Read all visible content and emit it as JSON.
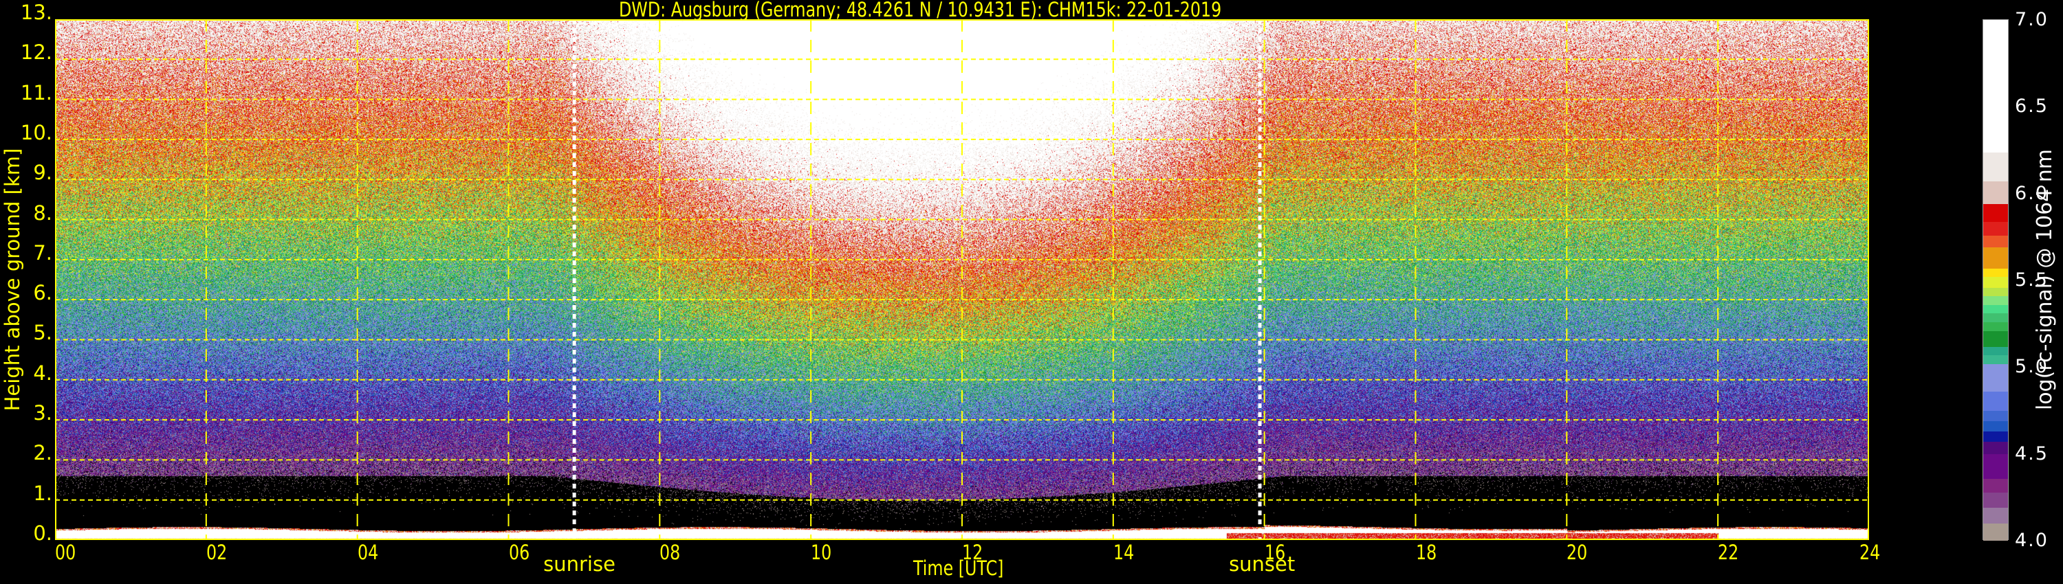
{
  "chart_data": {
    "type": "heatmap",
    "title": "DWD: Augsburg (Germany; 48.4261 N / 10.9431 E):    CHM15k: 22-01-2019",
    "xlabel": "Time [UTC]",
    "ylabel": "Height above ground [km]",
    "xlim": [
      0,
      24
    ],
    "ylim": [
      0,
      13
    ],
    "x_ticks": [
      0,
      2,
      4,
      6,
      8,
      10,
      12,
      14,
      16,
      18,
      20,
      22,
      24
    ],
    "x_tick_labels": [
      "00",
      "02",
      "04",
      "06",
      "08",
      "10",
      "12",
      "14",
      "16",
      "18",
      "20",
      "22",
      "24"
    ],
    "y_ticks": [
      0,
      1,
      2,
      3,
      4,
      5,
      6,
      7,
      8,
      9,
      10,
      11,
      12,
      13
    ],
    "y_tick_labels": [
      "0.",
      "1.",
      "2.",
      "3.",
      "4.",
      "5.",
      "6.",
      "7.",
      "8.",
      "9.",
      "10.",
      "11.",
      "12.",
      "13."
    ],
    "grid": true,
    "annotations": [
      {
        "label": "sunrise",
        "time": 6.87
      },
      {
        "label": "sunset",
        "time": 15.94
      }
    ],
    "colorbar": {
      "label": "log(rc-signal) @ 1064 nm",
      "range": [
        4.0,
        7.0
      ],
      "ticks": [
        "4.0",
        "4.5",
        "5.0",
        "5.5",
        "6.0",
        "6.5",
        "7.0"
      ],
      "tick_values": [
        4.0,
        4.5,
        5.0,
        5.5,
        6.0,
        6.5,
        7.0
      ],
      "levels": [
        {
          "from": 4.0,
          "to": 4.1,
          "color": "#a89a90"
        },
        {
          "from": 4.1,
          "to": 4.19,
          "color": "#9878a0"
        },
        {
          "from": 4.19,
          "to": 4.28,
          "color": "#84448c"
        },
        {
          "from": 4.28,
          "to": 4.36,
          "color": "#822680"
        },
        {
          "from": 4.36,
          "to": 4.5,
          "color": "#6a0a88"
        },
        {
          "from": 4.5,
          "to": 4.57,
          "color": "#520a7c"
        },
        {
          "from": 4.57,
          "to": 4.63,
          "color": "#0c18a0"
        },
        {
          "from": 4.63,
          "to": 4.69,
          "color": "#2058c0"
        },
        {
          "from": 4.69,
          "to": 4.75,
          "color": "#4068d0"
        },
        {
          "from": 4.75,
          "to": 4.86,
          "color": "#6078e0"
        },
        {
          "from": 4.86,
          "to": 5.02,
          "color": "#8894e0"
        },
        {
          "from": 5.02,
          "to": 5.07,
          "color": "#3ab890"
        },
        {
          "from": 5.07,
          "to": 5.12,
          "color": "#28a888"
        },
        {
          "from": 5.12,
          "to": 5.21,
          "color": "#189430"
        },
        {
          "from": 5.21,
          "to": 5.26,
          "color": "#34b450"
        },
        {
          "from": 5.26,
          "to": 5.31,
          "color": "#40c070"
        },
        {
          "from": 5.31,
          "to": 5.36,
          "color": "#48dc88"
        },
        {
          "from": 5.36,
          "to": 5.41,
          "color": "#80e480"
        },
        {
          "from": 5.41,
          "to": 5.46,
          "color": "#b8e448"
        },
        {
          "from": 5.46,
          "to": 5.52,
          "color": "#e0f030"
        },
        {
          "from": 5.52,
          "to": 5.57,
          "color": "#ffe010"
        },
        {
          "from": 5.57,
          "to": 5.69,
          "color": "#e89810"
        },
        {
          "from": 5.69,
          "to": 5.76,
          "color": "#ec5828"
        },
        {
          "from": 5.76,
          "to": 5.84,
          "color": "#e0201c"
        },
        {
          "from": 5.84,
          "to": 5.94,
          "color": "#d80404"
        },
        {
          "from": 5.94,
          "to": 6.07,
          "color": "#dec4bc"
        },
        {
          "from": 6.07,
          "to": 6.24,
          "color": "#eee8e4"
        },
        {
          "from": 6.24,
          "to": 7.0,
          "color": "#ffffff"
        }
      ]
    }
  },
  "colors": {
    "axis": "#ffff00",
    "background": "#000000",
    "annotation_line": "#ffffff"
  }
}
